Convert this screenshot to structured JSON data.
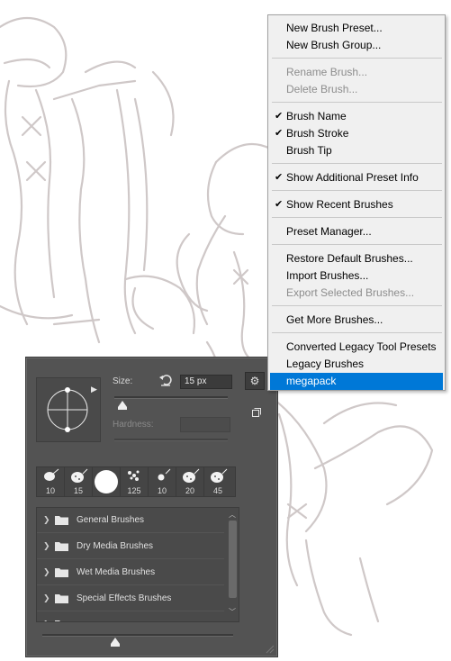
{
  "menu": {
    "items": [
      {
        "label": "New Brush Preset...",
        "checked": false,
        "disabled": false
      },
      {
        "label": "New Brush Group...",
        "checked": false,
        "disabled": false
      },
      {
        "label": "Rename Brush...",
        "checked": false,
        "disabled": true
      },
      {
        "label": "Delete Brush...",
        "checked": false,
        "disabled": true
      },
      {
        "label": "Brush Name",
        "checked": true,
        "disabled": false
      },
      {
        "label": "Brush Stroke",
        "checked": true,
        "disabled": false
      },
      {
        "label": "Brush Tip",
        "checked": false,
        "disabled": false
      },
      {
        "label": "Show Additional Preset Info",
        "checked": true,
        "disabled": false
      },
      {
        "label": "Show Recent Brushes",
        "checked": true,
        "disabled": false
      },
      {
        "label": "Preset Manager...",
        "checked": false,
        "disabled": false
      },
      {
        "label": "Restore Default Brushes...",
        "checked": false,
        "disabled": false
      },
      {
        "label": "Import Brushes...",
        "checked": false,
        "disabled": false
      },
      {
        "label": "Export Selected Brushes...",
        "checked": false,
        "disabled": true
      },
      {
        "label": "Get More Brushes...",
        "checked": false,
        "disabled": false
      },
      {
        "label": "Converted Legacy Tool Presets",
        "checked": false,
        "disabled": false
      },
      {
        "label": "Legacy Brushes",
        "checked": false,
        "disabled": false
      },
      {
        "label": "megapack",
        "checked": false,
        "disabled": false,
        "selected": true
      }
    ],
    "check_glyph": "✔"
  },
  "brush_panel": {
    "size_label": "Size:",
    "size_value": "15 px",
    "hardness_label": "Hardness:",
    "hardness_value": "",
    "size_slider_fraction": 0.07,
    "hardness_slider_fraction": 0.0,
    "preview_slider_fraction": 0.38,
    "gear_glyph": "⚙",
    "recent_brushes": [
      {
        "size": "10",
        "icon": "brush-splatter-icon"
      },
      {
        "size": "15",
        "icon": "brush-textured-icon"
      },
      {
        "size": "",
        "icon": "brush-round-hard-icon"
      },
      {
        "size": "125",
        "icon": "brush-scatter-icon"
      },
      {
        "size": "10",
        "icon": "brush-small-dot-icon"
      },
      {
        "size": "20",
        "icon": "brush-textured-icon"
      },
      {
        "size": "45",
        "icon": "brush-textured-icon"
      }
    ],
    "groups": [
      {
        "label": "General Brushes"
      },
      {
        "label": "Dry Media Brushes"
      },
      {
        "label": "Wet Media Brushes"
      },
      {
        "label": "Special Effects Brushes"
      },
      {
        "label": ""
      }
    ]
  },
  "colors": {
    "panel_bg": "#535353",
    "menu_bg": "#f0f0f0",
    "selection": "#0078d7",
    "sketch_line": "#cfc8c8"
  }
}
